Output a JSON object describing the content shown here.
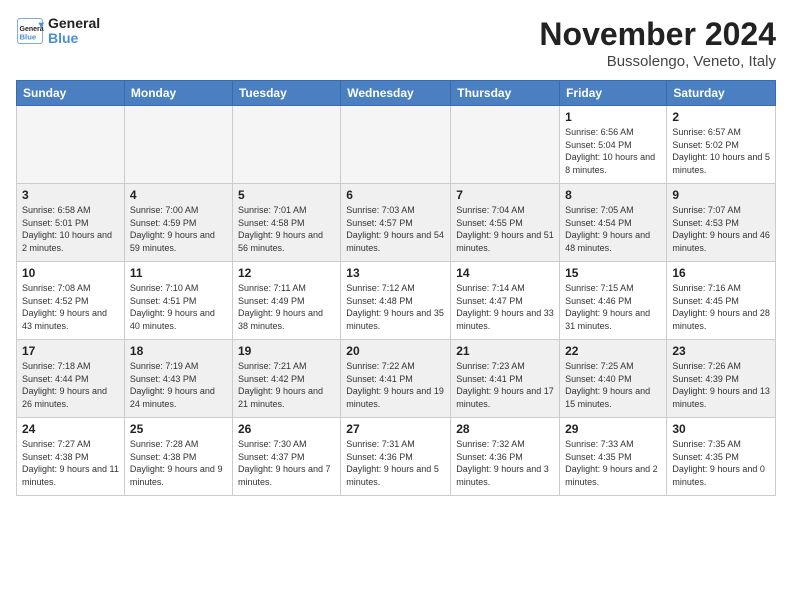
{
  "header": {
    "logo_line1": "General",
    "logo_line2": "Blue",
    "month_title": "November 2024",
    "location": "Bussolengo, Veneto, Italy"
  },
  "weekdays": [
    "Sunday",
    "Monday",
    "Tuesday",
    "Wednesday",
    "Thursday",
    "Friday",
    "Saturday"
  ],
  "weeks": [
    [
      {
        "day": "",
        "empty": true
      },
      {
        "day": "",
        "empty": true
      },
      {
        "day": "",
        "empty": true
      },
      {
        "day": "",
        "empty": true
      },
      {
        "day": "",
        "empty": true
      },
      {
        "day": "1",
        "sunrise": "6:56 AM",
        "sunset": "5:04 PM",
        "daylight": "10 hours and 8 minutes."
      },
      {
        "day": "2",
        "sunrise": "6:57 AM",
        "sunset": "5:02 PM",
        "daylight": "10 hours and 5 minutes."
      }
    ],
    [
      {
        "day": "3",
        "sunrise": "6:58 AM",
        "sunset": "5:01 PM",
        "daylight": "10 hours and 2 minutes."
      },
      {
        "day": "4",
        "sunrise": "7:00 AM",
        "sunset": "4:59 PM",
        "daylight": "9 hours and 59 minutes."
      },
      {
        "day": "5",
        "sunrise": "7:01 AM",
        "sunset": "4:58 PM",
        "daylight": "9 hours and 56 minutes."
      },
      {
        "day": "6",
        "sunrise": "7:03 AM",
        "sunset": "4:57 PM",
        "daylight": "9 hours and 54 minutes."
      },
      {
        "day": "7",
        "sunrise": "7:04 AM",
        "sunset": "4:55 PM",
        "daylight": "9 hours and 51 minutes."
      },
      {
        "day": "8",
        "sunrise": "7:05 AM",
        "sunset": "4:54 PM",
        "daylight": "9 hours and 48 minutes."
      },
      {
        "day": "9",
        "sunrise": "7:07 AM",
        "sunset": "4:53 PM",
        "daylight": "9 hours and 46 minutes."
      }
    ],
    [
      {
        "day": "10",
        "sunrise": "7:08 AM",
        "sunset": "4:52 PM",
        "daylight": "9 hours and 43 minutes."
      },
      {
        "day": "11",
        "sunrise": "7:10 AM",
        "sunset": "4:51 PM",
        "daylight": "9 hours and 40 minutes."
      },
      {
        "day": "12",
        "sunrise": "7:11 AM",
        "sunset": "4:49 PM",
        "daylight": "9 hours and 38 minutes."
      },
      {
        "day": "13",
        "sunrise": "7:12 AM",
        "sunset": "4:48 PM",
        "daylight": "9 hours and 35 minutes."
      },
      {
        "day": "14",
        "sunrise": "7:14 AM",
        "sunset": "4:47 PM",
        "daylight": "9 hours and 33 minutes."
      },
      {
        "day": "15",
        "sunrise": "7:15 AM",
        "sunset": "4:46 PM",
        "daylight": "9 hours and 31 minutes."
      },
      {
        "day": "16",
        "sunrise": "7:16 AM",
        "sunset": "4:45 PM",
        "daylight": "9 hours and 28 minutes."
      }
    ],
    [
      {
        "day": "17",
        "sunrise": "7:18 AM",
        "sunset": "4:44 PM",
        "daylight": "9 hours and 26 minutes."
      },
      {
        "day": "18",
        "sunrise": "7:19 AM",
        "sunset": "4:43 PM",
        "daylight": "9 hours and 24 minutes."
      },
      {
        "day": "19",
        "sunrise": "7:21 AM",
        "sunset": "4:42 PM",
        "daylight": "9 hours and 21 minutes."
      },
      {
        "day": "20",
        "sunrise": "7:22 AM",
        "sunset": "4:41 PM",
        "daylight": "9 hours and 19 minutes."
      },
      {
        "day": "21",
        "sunrise": "7:23 AM",
        "sunset": "4:41 PM",
        "daylight": "9 hours and 17 minutes."
      },
      {
        "day": "22",
        "sunrise": "7:25 AM",
        "sunset": "4:40 PM",
        "daylight": "9 hours and 15 minutes."
      },
      {
        "day": "23",
        "sunrise": "7:26 AM",
        "sunset": "4:39 PM",
        "daylight": "9 hours and 13 minutes."
      }
    ],
    [
      {
        "day": "24",
        "sunrise": "7:27 AM",
        "sunset": "4:38 PM",
        "daylight": "9 hours and 11 minutes."
      },
      {
        "day": "25",
        "sunrise": "7:28 AM",
        "sunset": "4:38 PM",
        "daylight": "9 hours and 9 minutes."
      },
      {
        "day": "26",
        "sunrise": "7:30 AM",
        "sunset": "4:37 PM",
        "daylight": "9 hours and 7 minutes."
      },
      {
        "day": "27",
        "sunrise": "7:31 AM",
        "sunset": "4:36 PM",
        "daylight": "9 hours and 5 minutes."
      },
      {
        "day": "28",
        "sunrise": "7:32 AM",
        "sunset": "4:36 PM",
        "daylight": "9 hours and 3 minutes."
      },
      {
        "day": "29",
        "sunrise": "7:33 AM",
        "sunset": "4:35 PM",
        "daylight": "9 hours and 2 minutes."
      },
      {
        "day": "30",
        "sunrise": "7:35 AM",
        "sunset": "4:35 PM",
        "daylight": "9 hours and 0 minutes."
      }
    ]
  ]
}
